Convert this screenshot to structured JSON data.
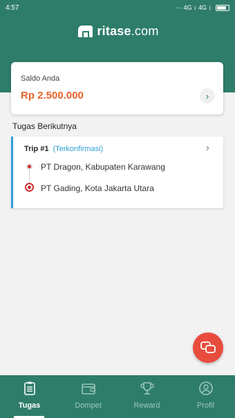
{
  "status_bar": {
    "time": "4:57",
    "indicators": "··· 4G ↕ 4G ↕"
  },
  "header": {
    "logo_icon": "ritase-logo-icon",
    "logo_text_bold": "ritase",
    "logo_text_thin": ".com"
  },
  "saldo": {
    "label": "Saldo Anda",
    "value": "Rp 2.500.000",
    "chevron": "›"
  },
  "tasks": {
    "section_title": "Tugas Berikutnya",
    "trip": {
      "label": "Trip #1",
      "status": "(Terkonfirmasi)",
      "chevron": "›",
      "origin": "PT Dragon, Kabupaten Karawang",
      "destination": "PT Gading, Kota Jakarta Utara"
    }
  },
  "fab": {
    "icon": "chat-icon"
  },
  "bottom_nav": {
    "items": [
      {
        "label": "Tugas",
        "icon": "clipboard-icon",
        "active": true
      },
      {
        "label": "Dompet",
        "icon": "wallet-icon",
        "active": false
      },
      {
        "label": "Reward",
        "icon": "trophy-icon",
        "active": false
      },
      {
        "label": "Profil",
        "icon": "profile-icon",
        "active": false
      }
    ]
  },
  "colors": {
    "primary": "#2e7d6a",
    "accent_orange": "#e8622a",
    "accent_blue": "#2e9fd6",
    "fab_red": "#e84c3d"
  }
}
